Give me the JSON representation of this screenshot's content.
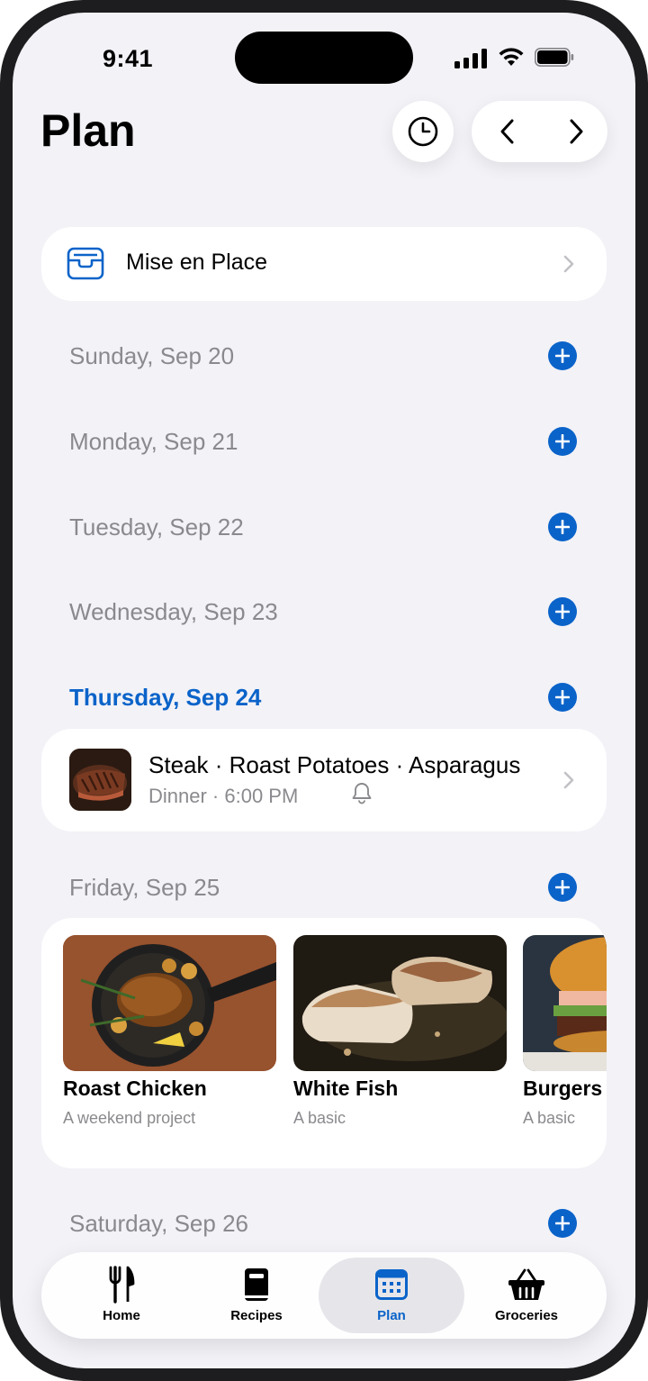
{
  "status_bar": {
    "time": "9:41"
  },
  "header": {
    "title": "Plan",
    "history_icon": "clock-icon",
    "prev_icon": "chevron-left-icon",
    "next_icon": "chevron-right-icon"
  },
  "mise_en_place": {
    "label": "Mise en Place",
    "icon": "tray-icon"
  },
  "days": [
    {
      "label": "Sunday, Sep 20"
    },
    {
      "label": "Monday, Sep 21"
    },
    {
      "label": "Tuesday, Sep 22"
    },
    {
      "label": "Wednesday, Sep 23"
    },
    {
      "label": "Thursday, Sep 24",
      "current": true
    },
    {
      "label": "Friday, Sep 25"
    },
    {
      "label": "Saturday, Sep 26"
    }
  ],
  "meal": {
    "title": "Steak · Roast Potatoes · Asparagus",
    "subtitle": "Dinner · 6:00 PM",
    "icon": "bell-icon"
  },
  "suggestions": [
    {
      "title": "Roast Chicken",
      "subtitle": "A weekend project"
    },
    {
      "title": "White Fish",
      "subtitle": "A basic"
    },
    {
      "title": "Burgers",
      "subtitle": "A basic"
    }
  ],
  "tabbar": {
    "tabs": [
      {
        "label": "Home",
        "icon": "fork-knife-icon"
      },
      {
        "label": "Recipes",
        "icon": "book-icon"
      },
      {
        "label": "Plan",
        "icon": "calendar-icon",
        "active": true
      },
      {
        "label": "Groceries",
        "icon": "basket-icon"
      }
    ]
  },
  "colors": {
    "accent": "#0a63c9",
    "background": "#f2f2f7",
    "secondary_text": "#8a8a8e"
  }
}
